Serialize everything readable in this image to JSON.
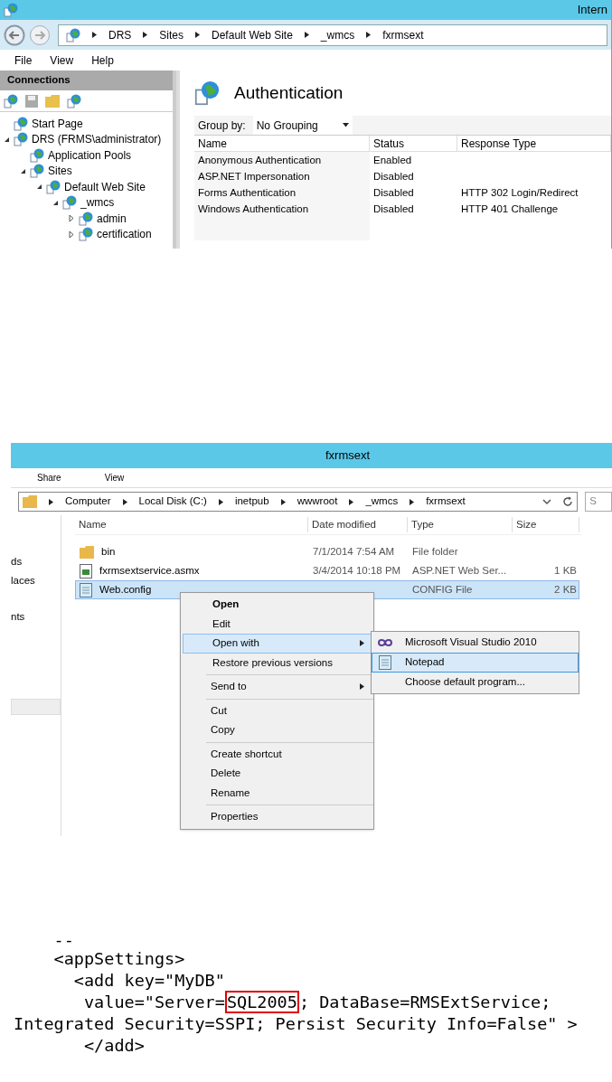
{
  "iis": {
    "title": "Intern",
    "breadcrumb": [
      "DRS",
      "Sites",
      "Default Web Site",
      "_wmcs",
      "fxrmsext"
    ],
    "menu": [
      "File",
      "View",
      "Help"
    ],
    "connections": {
      "title": "Connections",
      "tree": [
        {
          "label": "Start Page"
        },
        {
          "label": "DRS (FRMS\\administrator)",
          "expanded": true,
          "children": [
            {
              "label": "Application Pools"
            },
            {
              "label": "Sites",
              "expanded": true,
              "children": [
                {
                  "label": "Default Web Site",
                  "expanded": true,
                  "children": [
                    {
                      "label": "_wmcs",
                      "expanded": true,
                      "children": [
                        {
                          "label": "admin",
                          "expanded": false
                        },
                        {
                          "label": "certification",
                          "expanded": false
                        }
                      ]
                    }
                  ]
                }
              ]
            }
          ]
        }
      ]
    },
    "feature": {
      "title": "Authentication",
      "group_by_label": "Group by:",
      "group_by_value": "No Grouping",
      "columns": [
        "Name",
        "Status",
        "Response Type"
      ],
      "rows": [
        {
          "name": "Anonymous Authentication",
          "status": "Enabled"
        },
        {
          "name": "ASP.NET Impersonation",
          "status": "Disabled"
        },
        {
          "name": "Forms Authentication",
          "status": "Disabled",
          "response": "HTTP 302 Login/Redirect"
        },
        {
          "name": "Windows Authentication",
          "status": "Disabled",
          "response": "HTTP 401 Challenge"
        }
      ]
    }
  },
  "explorer": {
    "title": "fxrmsext",
    "ribbon": [
      "Share",
      "View"
    ],
    "breadcrumb": [
      "Computer",
      "Local Disk (C:)",
      "inetpub",
      "wwwroot",
      "_wmcs",
      "fxrmsext"
    ],
    "search_placeholder": "S",
    "nav": [
      "ds",
      "laces",
      "nts"
    ],
    "columns": [
      "Name",
      "Date modified",
      "Type",
      "Size"
    ],
    "files": [
      {
        "kind": "folder",
        "name": "bin",
        "date": "7/1/2014 7:54 AM",
        "type": "File folder",
        "selected": false
      },
      {
        "kind": "asmx",
        "name": "fxrmsextservice.asmx",
        "date": "3/4/2014 10:18 PM",
        "type": "ASP.NET Web Ser...",
        "size": "1 KB",
        "selected": false
      },
      {
        "kind": "config",
        "name": "Web.config",
        "type": "CONFIG File",
        "size": "2 KB",
        "selected": true
      }
    ],
    "context_menu": [
      [
        {
          "label": "Open",
          "bold": true,
          "selected": false
        },
        {
          "label": "Edit",
          "selected": false
        },
        {
          "label": "Open with",
          "submenu": true,
          "selected": true
        },
        {
          "label": "Restore previous versions",
          "selected": false
        }
      ],
      [
        {
          "label": "Send to",
          "submenu": true,
          "selected": false
        }
      ],
      [
        {
          "label": "Cut",
          "selected": false
        },
        {
          "label": "Copy",
          "selected": false
        }
      ],
      [
        {
          "label": "Create shortcut",
          "selected": false
        },
        {
          "label": "Delete",
          "selected": false
        },
        {
          "label": "Rename",
          "selected": false
        }
      ],
      [
        {
          "label": "Properties",
          "selected": false
        }
      ]
    ],
    "submenu": [
      {
        "kind": "vs",
        "label": "Microsoft Visual Studio 2010",
        "selected": false
      },
      {
        "kind": "notepad",
        "label": "Notepad",
        "selected": true
      },
      {
        "kind": "none",
        "label": "Choose default program...",
        "selected": false
      }
    ]
  },
  "code": {
    "lines": [
      {
        "kind": "outer",
        "text": "--"
      },
      {
        "kind": "outer",
        "text": "<appSettings>"
      },
      {
        "kind": "inner",
        "text": "<add key=\"MyDB\""
      },
      {
        "kind": "attr",
        "before": "value=\"Server=",
        "highlight": "SQL2005",
        "after": "; DataBase=RMSExtService;"
      },
      {
        "kind": "wrapped",
        "text": "Integrated Security=SSPI; Persist Security Info=False\" >"
      },
      {
        "kind": "attr",
        "text": "</add>"
      }
    ]
  }
}
